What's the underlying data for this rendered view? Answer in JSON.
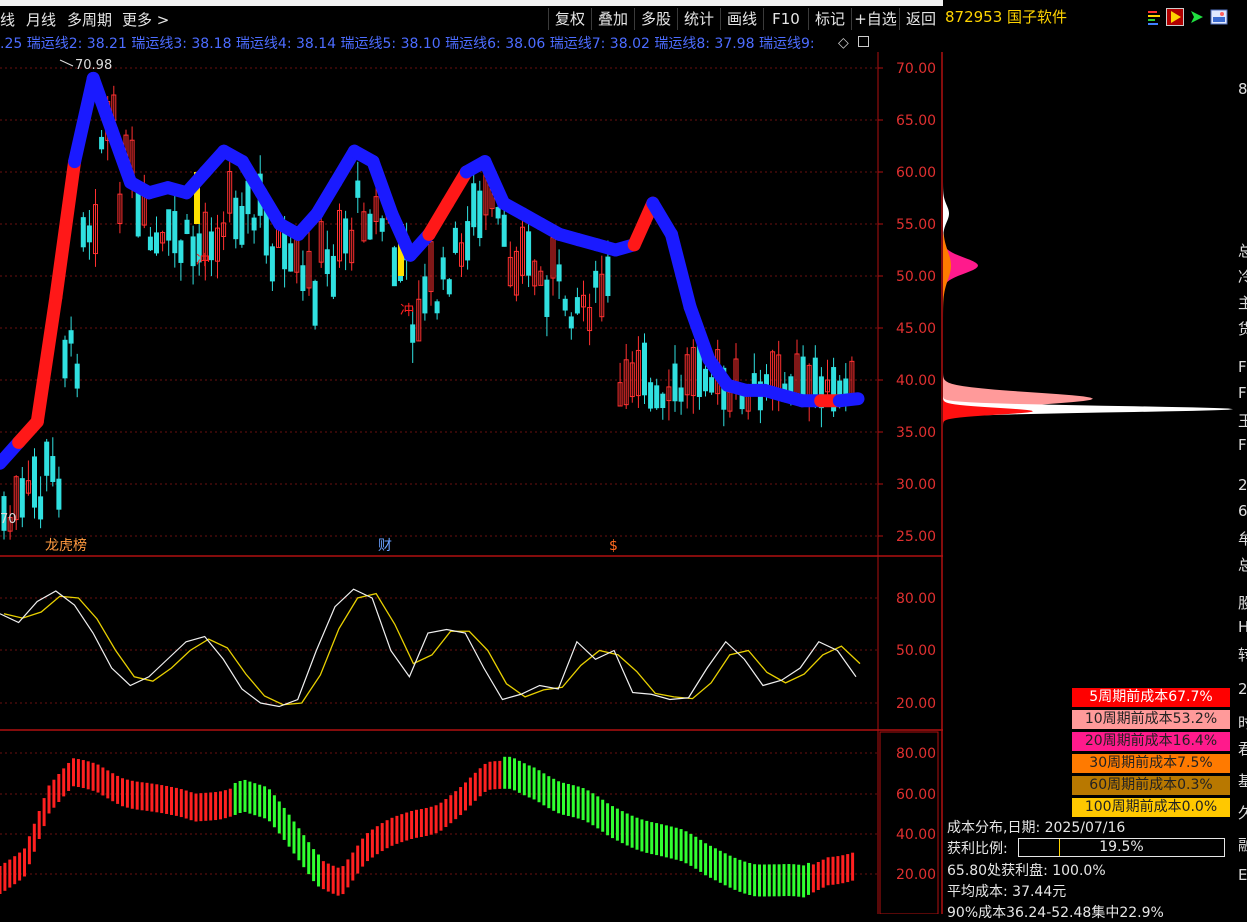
{
  "toolbar": {
    "left_items": [
      "线",
      "月线",
      "多周期",
      "更多 >"
    ],
    "buttons": [
      "复权",
      "叠加",
      "多股",
      "统计",
      "画线",
      "F10",
      "标记",
      "+自选",
      "返回"
    ]
  },
  "stock": {
    "code_name": "872953 国子软件"
  },
  "indicator_line": ".25  瑞运线2: 38.21  瑞运线3: 38.18  瑞运线4: 38.14  瑞运线5: 38.10  瑞运线6: 38.06  瑞运线7: 38.02  瑞运线8: 37.98  瑞运线9:",
  "main_chart": {
    "price_axis": [
      "70.00",
      "65.00",
      "60.00",
      "55.00",
      "50.00",
      "45.00",
      "40.00",
      "35.00",
      "30.00",
      "25.00"
    ],
    "high_label": "70.98",
    "left_low_label": "70",
    "markers": [
      "冲",
      "冲"
    ],
    "bottom_tags": [
      "龙虎榜",
      "财",
      "$"
    ]
  },
  "osc_chart": {
    "axis": [
      "80.00",
      "50.00",
      "20.00"
    ]
  },
  "macd_chart": {
    "axis": [
      "80.00",
      "60.00",
      "40.00",
      "20.00"
    ]
  },
  "chart_data": [
    {
      "type": "line",
      "title": "",
      "series": [
        {
          "name": "",
          "values": [
            32,
            34,
            36,
            48,
            61,
            69,
            64,
            59,
            58,
            58.5,
            58,
            60,
            62,
            61,
            58,
            55,
            54,
            56,
            59,
            62,
            61,
            56,
            52,
            54,
            57,
            60,
            61,
            57,
            56,
            55,
            54,
            53.5,
            53,
            52.5,
            53,
            57,
            54,
            47,
            42,
            39.5,
            39,
            39,
            38.5,
            38,
            38,
            38,
            38.2
          ]
        }
      ],
      "ylim": [
        24,
        72
      ]
    },
    {
      "type": "line",
      "series": [
        {
          "name": "",
          "values": [
            71,
            66,
            78,
            84,
            76,
            60,
            40,
            30,
            35,
            45,
            55,
            58,
            45,
            28,
            20,
            18,
            22,
            50,
            75,
            85,
            80,
            50,
            35,
            60,
            62,
            60,
            40,
            22,
            25,
            30,
            28,
            55,
            45,
            50,
            26,
            25,
            22,
            23,
            40,
            55,
            45,
            30,
            33,
            40,
            55,
            50,
            35
          ]
        }
      ],
      "ylim": [
        10,
        95
      ]
    },
    {
      "type": "bar",
      "values": [
        20,
        30,
        60,
        72,
        70,
        65,
        62,
        58,
        55,
        58,
        62,
        56,
        40,
        25,
        20,
        35,
        42,
        48,
        52,
        60,
        70,
        72,
        68,
        60,
        55,
        48,
        44,
        40,
        35,
        28,
        24,
        20,
        18,
        17,
        25,
        28
      ],
      "ylim": [
        10,
        90
      ]
    }
  ],
  "cost_distribution": {
    "legend": [
      {
        "label": "5周期前成本67.7%",
        "bg": "#ff0000",
        "fg": "#ffffff"
      },
      {
        "label": "10周期前成本53.2%",
        "bg": "#ff9a9a",
        "fg": "#222222"
      },
      {
        "label": "20周期前成本16.4%",
        "bg": "#ff1a8c",
        "fg": "#222222"
      },
      {
        "label": "30周期前成本7.5%",
        "bg": "#ff7a00",
        "fg": "#222222"
      },
      {
        "label": "60周期前成本0.3%",
        "bg": "#b87800",
        "fg": "#222222"
      },
      {
        "label": "100周期前成本0.0%",
        "bg": "#ffc800",
        "fg": "#222222"
      }
    ],
    "date_line": "成本分布,日期:  2025/07/16",
    "profit_label": "获利比例:",
    "profit_value": "19.5%",
    "profit_fraction": 0.195,
    "profit_at": "65.80处获利盘:  100.0%",
    "avg_cost": "平均成本:  37.44元",
    "range90": "90%成本36.24-52.48集中22.9%"
  },
  "edge_chars": [
    "8",
    "总",
    "冷",
    "主",
    "货",
    "F",
    "F",
    "王",
    "F",
    "2",
    "6",
    "牟",
    "总",
    "股",
    "H",
    "转",
    "2",
    "时",
    "君",
    "基",
    "久",
    "融",
    "E"
  ]
}
